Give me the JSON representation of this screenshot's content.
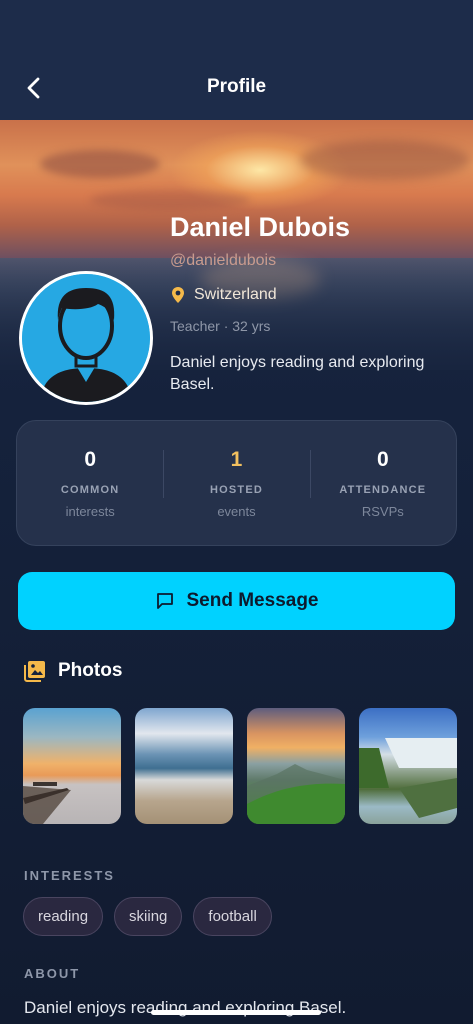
{
  "header": {
    "title": "Profile"
  },
  "profile": {
    "name": "Daniel Dubois",
    "handle": "@danieldubois",
    "location": "Switzerland",
    "meta": "Teacher · 32 yrs",
    "bio": "Daniel enjoys reading and exploring Basel."
  },
  "stats": [
    {
      "value": "0",
      "label": "COMMON",
      "sub": "interests"
    },
    {
      "value": "1",
      "label": "HOSTED",
      "sub": "events"
    },
    {
      "value": "0",
      "label": "ATTENDANCE",
      "sub": "RSVPs"
    }
  ],
  "actions": {
    "send_message": "Send Message"
  },
  "photos": {
    "title": "Photos",
    "items": [
      "pier-sunset",
      "beach-waves",
      "green-hills-sunset",
      "waterfall"
    ]
  },
  "interests": {
    "label": "INTERESTS",
    "items": [
      "reading",
      "skiing",
      "football"
    ]
  },
  "about": {
    "label": "ABOUT",
    "text": "Daniel enjoys reading and exploring Basel."
  },
  "colors": {
    "accent": "#00d2ff",
    "hosted_value": "#f2c05f",
    "location_pin": "#f5b94a",
    "background": "#14203a"
  },
  "icons": {
    "back": "chevron-left-icon",
    "location": "map-pin-icon",
    "message": "message-square-icon",
    "photos": "photo-album-icon"
  }
}
